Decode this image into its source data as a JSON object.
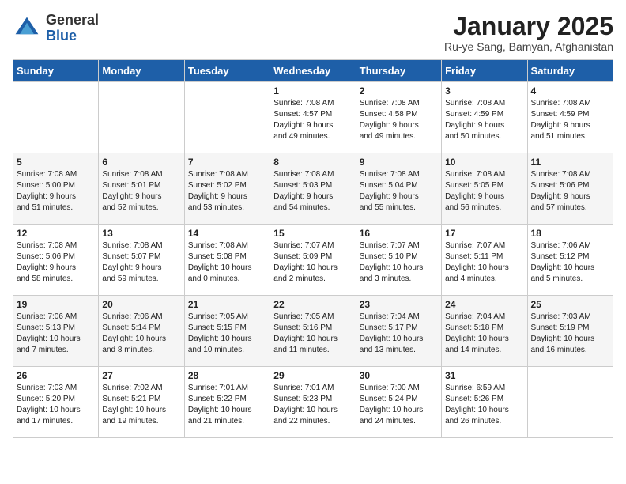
{
  "logo": {
    "general": "General",
    "blue": "Blue"
  },
  "title": {
    "main": "January 2025",
    "sub": "Ru-ye Sang, Bamyan, Afghanistan"
  },
  "weekdays": [
    "Sunday",
    "Monday",
    "Tuesday",
    "Wednesday",
    "Thursday",
    "Friday",
    "Saturday"
  ],
  "weeks": [
    [
      {
        "day": "",
        "info": ""
      },
      {
        "day": "",
        "info": ""
      },
      {
        "day": "",
        "info": ""
      },
      {
        "day": "1",
        "info": "Sunrise: 7:08 AM\nSunset: 4:57 PM\nDaylight: 9 hours\nand 49 minutes."
      },
      {
        "day": "2",
        "info": "Sunrise: 7:08 AM\nSunset: 4:58 PM\nDaylight: 9 hours\nand 49 minutes."
      },
      {
        "day": "3",
        "info": "Sunrise: 7:08 AM\nSunset: 4:59 PM\nDaylight: 9 hours\nand 50 minutes."
      },
      {
        "day": "4",
        "info": "Sunrise: 7:08 AM\nSunset: 4:59 PM\nDaylight: 9 hours\nand 51 minutes."
      }
    ],
    [
      {
        "day": "5",
        "info": "Sunrise: 7:08 AM\nSunset: 5:00 PM\nDaylight: 9 hours\nand 51 minutes."
      },
      {
        "day": "6",
        "info": "Sunrise: 7:08 AM\nSunset: 5:01 PM\nDaylight: 9 hours\nand 52 minutes."
      },
      {
        "day": "7",
        "info": "Sunrise: 7:08 AM\nSunset: 5:02 PM\nDaylight: 9 hours\nand 53 minutes."
      },
      {
        "day": "8",
        "info": "Sunrise: 7:08 AM\nSunset: 5:03 PM\nDaylight: 9 hours\nand 54 minutes."
      },
      {
        "day": "9",
        "info": "Sunrise: 7:08 AM\nSunset: 5:04 PM\nDaylight: 9 hours\nand 55 minutes."
      },
      {
        "day": "10",
        "info": "Sunrise: 7:08 AM\nSunset: 5:05 PM\nDaylight: 9 hours\nand 56 minutes."
      },
      {
        "day": "11",
        "info": "Sunrise: 7:08 AM\nSunset: 5:06 PM\nDaylight: 9 hours\nand 57 minutes."
      }
    ],
    [
      {
        "day": "12",
        "info": "Sunrise: 7:08 AM\nSunset: 5:06 PM\nDaylight: 9 hours\nand 58 minutes."
      },
      {
        "day": "13",
        "info": "Sunrise: 7:08 AM\nSunset: 5:07 PM\nDaylight: 9 hours\nand 59 minutes."
      },
      {
        "day": "14",
        "info": "Sunrise: 7:08 AM\nSunset: 5:08 PM\nDaylight: 10 hours\nand 0 minutes."
      },
      {
        "day": "15",
        "info": "Sunrise: 7:07 AM\nSunset: 5:09 PM\nDaylight: 10 hours\nand 2 minutes."
      },
      {
        "day": "16",
        "info": "Sunrise: 7:07 AM\nSunset: 5:10 PM\nDaylight: 10 hours\nand 3 minutes."
      },
      {
        "day": "17",
        "info": "Sunrise: 7:07 AM\nSunset: 5:11 PM\nDaylight: 10 hours\nand 4 minutes."
      },
      {
        "day": "18",
        "info": "Sunrise: 7:06 AM\nSunset: 5:12 PM\nDaylight: 10 hours\nand 5 minutes."
      }
    ],
    [
      {
        "day": "19",
        "info": "Sunrise: 7:06 AM\nSunset: 5:13 PM\nDaylight: 10 hours\nand 7 minutes."
      },
      {
        "day": "20",
        "info": "Sunrise: 7:06 AM\nSunset: 5:14 PM\nDaylight: 10 hours\nand 8 minutes."
      },
      {
        "day": "21",
        "info": "Sunrise: 7:05 AM\nSunset: 5:15 PM\nDaylight: 10 hours\nand 10 minutes."
      },
      {
        "day": "22",
        "info": "Sunrise: 7:05 AM\nSunset: 5:16 PM\nDaylight: 10 hours\nand 11 minutes."
      },
      {
        "day": "23",
        "info": "Sunrise: 7:04 AM\nSunset: 5:17 PM\nDaylight: 10 hours\nand 13 minutes."
      },
      {
        "day": "24",
        "info": "Sunrise: 7:04 AM\nSunset: 5:18 PM\nDaylight: 10 hours\nand 14 minutes."
      },
      {
        "day": "25",
        "info": "Sunrise: 7:03 AM\nSunset: 5:19 PM\nDaylight: 10 hours\nand 16 minutes."
      }
    ],
    [
      {
        "day": "26",
        "info": "Sunrise: 7:03 AM\nSunset: 5:20 PM\nDaylight: 10 hours\nand 17 minutes."
      },
      {
        "day": "27",
        "info": "Sunrise: 7:02 AM\nSunset: 5:21 PM\nDaylight: 10 hours\nand 19 minutes."
      },
      {
        "day": "28",
        "info": "Sunrise: 7:01 AM\nSunset: 5:22 PM\nDaylight: 10 hours\nand 21 minutes."
      },
      {
        "day": "29",
        "info": "Sunrise: 7:01 AM\nSunset: 5:23 PM\nDaylight: 10 hours\nand 22 minutes."
      },
      {
        "day": "30",
        "info": "Sunrise: 7:00 AM\nSunset: 5:24 PM\nDaylight: 10 hours\nand 24 minutes."
      },
      {
        "day": "31",
        "info": "Sunrise: 6:59 AM\nSunset: 5:26 PM\nDaylight: 10 hours\nand 26 minutes."
      },
      {
        "day": "",
        "info": ""
      }
    ]
  ]
}
